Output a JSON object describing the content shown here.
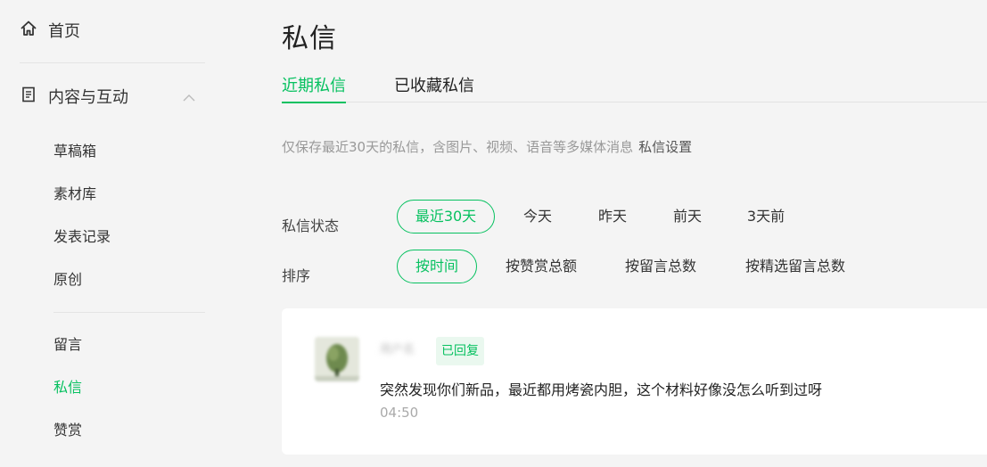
{
  "sidebar": {
    "home": {
      "label": "首页",
      "icon": "home-icon"
    },
    "group": {
      "label": "内容与互动",
      "icon": "document-icon",
      "expand_icon": "chevron-up-icon"
    },
    "items_a": [
      {
        "label": "草稿箱"
      },
      {
        "label": "素材库"
      },
      {
        "label": "发表记录"
      },
      {
        "label": "原创"
      }
    ],
    "items_b": [
      {
        "label": "留言"
      },
      {
        "label": "私信",
        "active": true
      },
      {
        "label": "赞赏"
      }
    ]
  },
  "main": {
    "title": "私信",
    "tabs": [
      {
        "label": "近期私信",
        "active": true
      },
      {
        "label": "已收藏私信"
      }
    ],
    "notice": {
      "text": "仅保存最近30天的私信，含图片、视频、语音等多媒体消息",
      "link": "私信设置"
    },
    "status_filter": {
      "label": "私信状态",
      "options": [
        "最近30天",
        "今天",
        "昨天",
        "前天",
        "3天前"
      ],
      "selected": "最近30天"
    },
    "sort_filter": {
      "label": "排序",
      "options": [
        "按时间",
        "按赞赏总额",
        "按留言总数",
        "按精选留言总数"
      ],
      "selected": "按时间"
    },
    "messages": [
      {
        "username": "用户名",
        "status": "已回复",
        "text": "突然发现你们新品，最近都用烤瓷内胆，这个材料好像没怎么听到过呀",
        "time": "04:50"
      }
    ]
  },
  "colors": {
    "accent": "#07c160",
    "background": "#f4f4f4",
    "card": "#ffffff",
    "muted_text": "#999999"
  }
}
